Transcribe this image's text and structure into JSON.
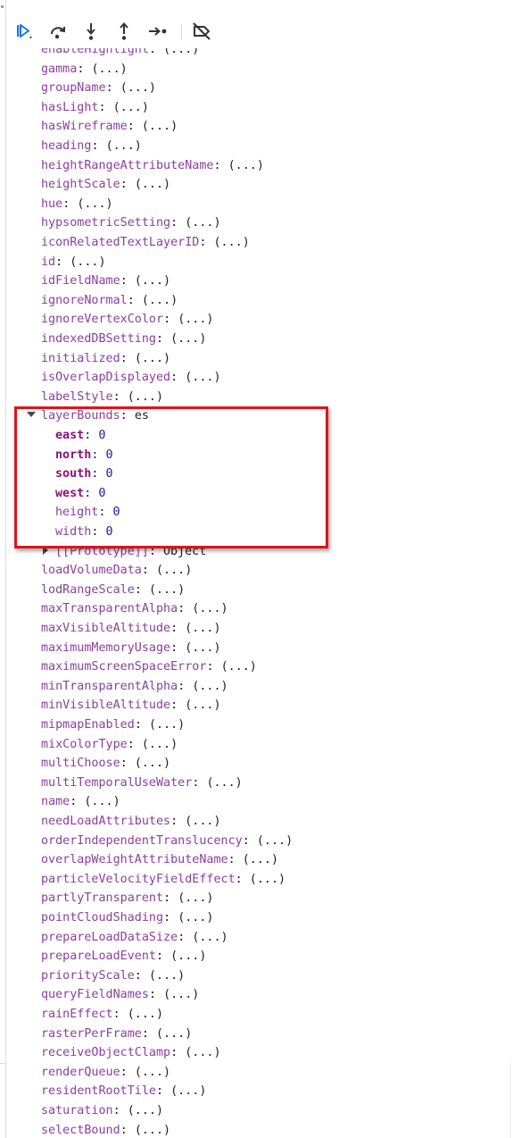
{
  "toolbar": {
    "buttons": [
      {
        "name": "resume-icon",
        "label": "Resume script execution"
      },
      {
        "name": "step-over-icon",
        "label": "Step over next function call"
      },
      {
        "name": "step-into-icon",
        "label": "Step into next function call"
      },
      {
        "name": "step-out-icon",
        "label": "Step out of current function"
      },
      {
        "name": "step-icon",
        "label": "Step"
      },
      {
        "name": "deactivate-breakpoints-icon",
        "label": "Deactivate breakpoints"
      }
    ],
    "accent_color": "#1a73e8"
  },
  "tree": {
    "getter_text": "(...)",
    "colon": ":",
    "rows_before": [
      "enableHighlight",
      "gamma",
      "groupName",
      "hasLight",
      "hasWireframe",
      "heading",
      "heightRangeAttributeName",
      "heightScale",
      "hue",
      "hypsometricSetting",
      "iconRelatedTextLayerID",
      "id",
      "idFieldName",
      "ignoreNormal",
      "ignoreVertexColor",
      "indexedDBSetting",
      "initialized",
      "isOverlapDisplayed",
      "labelStyle"
    ],
    "expanded": {
      "key": "layerBounds",
      "type_label": "es",
      "children": [
        {
          "key": "east",
          "value": "0",
          "own": true
        },
        {
          "key": "north",
          "value": "0",
          "own": true
        },
        {
          "key": "south",
          "value": "0",
          "own": true
        },
        {
          "key": "west",
          "value": "0",
          "own": true
        },
        {
          "key": "height",
          "value": "0",
          "own": false
        },
        {
          "key": "width",
          "value": "0",
          "own": false
        }
      ],
      "prototype_key": "[[Prototype]]",
      "prototype_value": "Object"
    },
    "rows_after": [
      "loadVolumeData",
      "lodRangeScale",
      "maxTransparentAlpha",
      "maxVisibleAltitude",
      "maximumMemoryUsage",
      "maximumScreenSpaceError",
      "minTransparentAlpha",
      "minVisibleAltitude",
      "mipmapEnabled",
      "mixColorType",
      "multiChoose",
      "multiTemporalUseWater",
      "name",
      "needLoadAttributes",
      "orderIndependentTranslucency",
      "overlapWeightAttributeName",
      "particleVelocityFieldEffect",
      "partlyTransparent",
      "pointCloudShading",
      "prepareLoadDataSize",
      "prepareLoadEvent",
      "priorityScale",
      "queryFieldNames",
      "rainEffect",
      "rasterPerFrame",
      "receiveObjectClamp",
      "renderQueue",
      "residentRootTile",
      "saturation",
      "selectBound"
    ]
  },
  "colors": {
    "key": "#8b3f9e",
    "own_key": "#881280",
    "number": "#1a1aa6",
    "highlight_border": "#e0131a"
  }
}
